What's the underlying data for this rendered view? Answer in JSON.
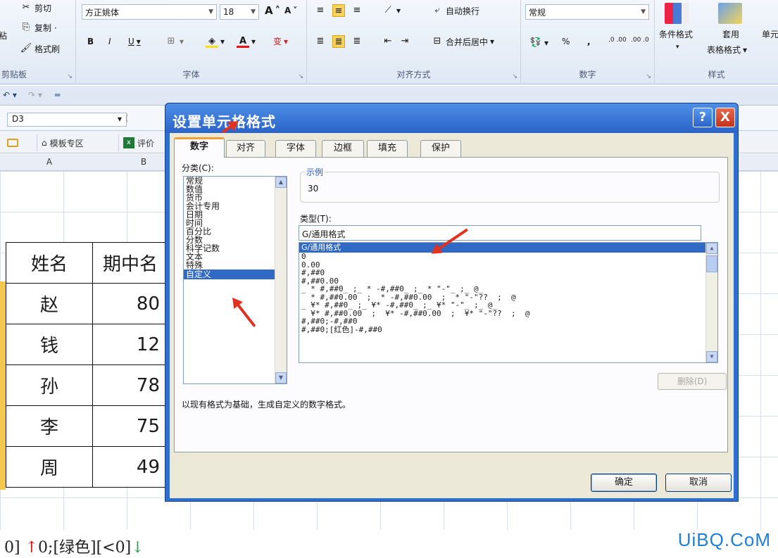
{
  "ribbon": {
    "clipboard": {
      "paste": "粘",
      "cut": "剪切",
      "copy": "复制 ·",
      "format_painter": "格式刷",
      "label": "剪贴板"
    },
    "font": {
      "name": "方正姚体",
      "size": "18",
      "grow": "A",
      "shrink": "A",
      "bold": "B",
      "italic": "I",
      "underline": "U",
      "wen": "变",
      "label": "字体"
    },
    "align": {
      "wrap": "自动换行",
      "merge": "合并后居中",
      "label": "对齐方式"
    },
    "number": {
      "format": "常规",
      "percent": "%",
      "comma": ",",
      "inc": ".0 .00",
      "dec": ".00 .0",
      "label": "数字"
    },
    "styles": {
      "cond": "条件格式",
      "table1": "套用",
      "table2": "表格格式",
      "cell": "单元",
      "label": "样式"
    }
  },
  "formula_bar": {
    "name_box": "D3",
    "fx": "("
  },
  "doc_tabs": {
    "template": "模板专区",
    "eval": "评价"
  },
  "columns": [
    "A",
    "B"
  ],
  "table": {
    "header": [
      "姓名",
      "期中名"
    ],
    "rows": [
      {
        "name": "赵",
        "score": "80"
      },
      {
        "name": "钱",
        "score": "12"
      },
      {
        "name": "孙",
        "score": "78"
      },
      {
        "name": "李",
        "score": "75"
      },
      {
        "name": "周",
        "score": "49"
      }
    ]
  },
  "bottom_formula": {
    "p1": "0]",
    "up": "↑",
    "p2": "0;[绿色][<0]",
    "down": "↓"
  },
  "watermark": "UiBQ.CoM",
  "dialog": {
    "title": "设置单元格格式",
    "help": "?",
    "close": "X",
    "tabs": [
      "数字",
      "对齐",
      "字体",
      "边框",
      "填充",
      "保护"
    ],
    "category_label": "分类(C):",
    "categories": [
      "常规",
      "数值",
      "货币",
      "会计专用",
      "日期",
      "时间",
      "百分比",
      "分数",
      "科学记数",
      "文本",
      "特殊",
      "自定义"
    ],
    "selected_category": "自定义",
    "sample_label": "示例",
    "sample_value": "30",
    "type_label": "类型(T):",
    "type_value": "G/通用格式",
    "formats": [
      "G/通用格式",
      "0",
      "0.00",
      "#,##0",
      "#,##0.00",
      "_ * #,##0_ ;_ * -#,##0_ ;_ * \"-\"_ ;_ @_",
      "_ * #,##0.00_ ;_ * -#,##0.00_ ;_ * \"-\"??_ ;_ @_",
      "_ ¥* #,##0_ ;_ ¥* -#,##0_ ;_ ¥* \"-\"_ ;_ @_",
      "_ ¥* #,##0.00_ ;_ ¥* -#,##0.00_ ;_ ¥* \"-\"??_ ;_ @_",
      "#,##0;-#,##0",
      "#,##0;[红色]-#,##0"
    ],
    "delete_btn": "删除(D)",
    "description": "以现有格式为基础，生成自定义的数字格式。",
    "ok": "确定",
    "cancel": "取消"
  }
}
